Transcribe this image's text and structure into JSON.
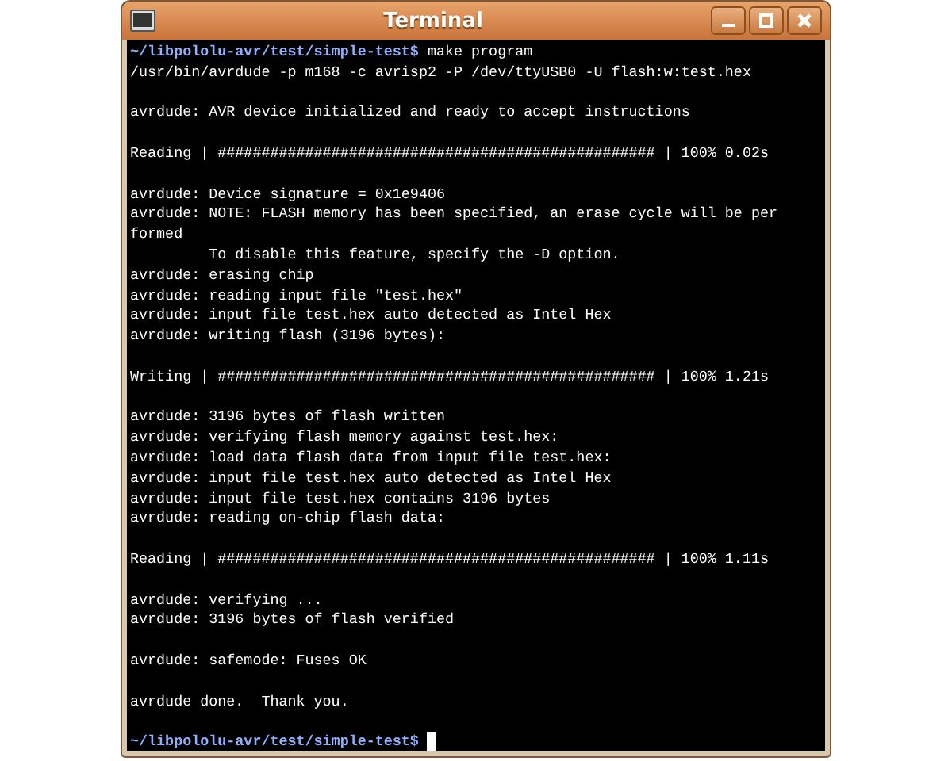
{
  "window": {
    "title": "Terminal"
  },
  "lines": [
    {
      "kind": "prompt",
      "prompt": "~/libpololu-avr/test/simple-test$",
      "command": "make program"
    },
    {
      "kind": "output",
      "text": "/usr/bin/avrdude -p m168 -c avrisp2 -P /dev/ttyUSB0 -U flash:w:test.hex"
    },
    {
      "kind": "blank"
    },
    {
      "kind": "output",
      "text": "avrdude: AVR device initialized and ready to accept instructions"
    },
    {
      "kind": "blank"
    },
    {
      "kind": "output",
      "text": "Reading | ################################################## | 100% 0.02s"
    },
    {
      "kind": "blank"
    },
    {
      "kind": "output",
      "text": "avrdude: Device signature = 0x1e9406"
    },
    {
      "kind": "output",
      "text": "avrdude: NOTE: FLASH memory has been specified, an erase cycle will be per"
    },
    {
      "kind": "output",
      "text": "formed"
    },
    {
      "kind": "output",
      "text": "         To disable this feature, specify the -D option."
    },
    {
      "kind": "output",
      "text": "avrdude: erasing chip"
    },
    {
      "kind": "output",
      "text": "avrdude: reading input file \"test.hex\""
    },
    {
      "kind": "output",
      "text": "avrdude: input file test.hex auto detected as Intel Hex"
    },
    {
      "kind": "output",
      "text": "avrdude: writing flash (3196 bytes):"
    },
    {
      "kind": "blank"
    },
    {
      "kind": "output",
      "text": "Writing | ################################################## | 100% 1.21s"
    },
    {
      "kind": "blank"
    },
    {
      "kind": "output",
      "text": "avrdude: 3196 bytes of flash written"
    },
    {
      "kind": "output",
      "text": "avrdude: verifying flash memory against test.hex:"
    },
    {
      "kind": "output",
      "text": "avrdude: load data flash data from input file test.hex:"
    },
    {
      "kind": "output",
      "text": "avrdude: input file test.hex auto detected as Intel Hex"
    },
    {
      "kind": "output",
      "text": "avrdude: input file test.hex contains 3196 bytes"
    },
    {
      "kind": "output",
      "text": "avrdude: reading on-chip flash data:"
    },
    {
      "kind": "blank"
    },
    {
      "kind": "output",
      "text": "Reading | ################################################## | 100% 1.11s"
    },
    {
      "kind": "blank"
    },
    {
      "kind": "output",
      "text": "avrdude: verifying ..."
    },
    {
      "kind": "output",
      "text": "avrdude: 3196 bytes of flash verified"
    },
    {
      "kind": "blank"
    },
    {
      "kind": "output",
      "text": "avrdude: safemode: Fuses OK"
    },
    {
      "kind": "blank"
    },
    {
      "kind": "output",
      "text": "avrdude done.  Thank you."
    },
    {
      "kind": "blank"
    },
    {
      "kind": "prompt",
      "prompt": "~/libpololu-avr/test/simple-test$",
      "cursor": true
    }
  ]
}
